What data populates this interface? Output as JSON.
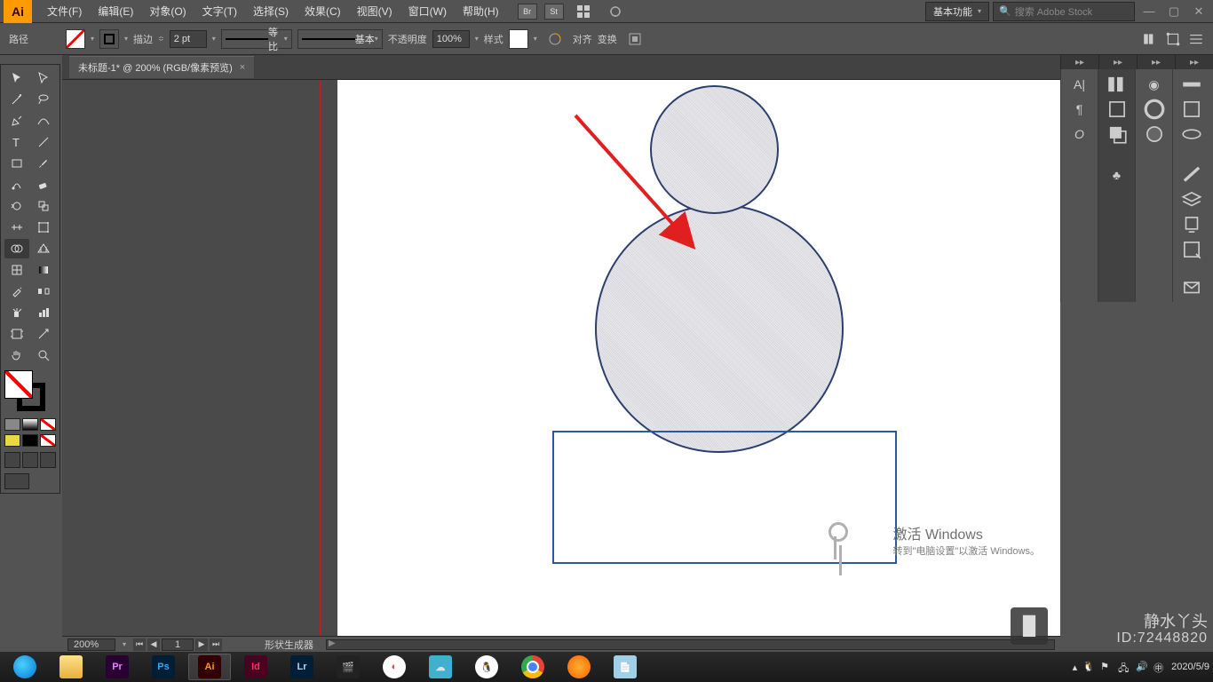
{
  "menubar": {
    "items": [
      "文件(F)",
      "编辑(E)",
      "对象(O)",
      "文字(T)",
      "选择(S)",
      "效果(C)",
      "视图(V)",
      "窗口(W)",
      "帮助(H)"
    ],
    "icon_boxes": [
      "Br",
      "St"
    ],
    "workspace": "基本功能",
    "search_placeholder": "搜索 Adobe Stock"
  },
  "controlbar": {
    "selection_label": "路径",
    "stroke_label": "描边",
    "stroke_weight": "2 pt",
    "profile_label": "等比",
    "brush_label": "基本",
    "opacity_label": "不透明度",
    "opacity_value": "100%",
    "style_label": "样式",
    "align_label": "对齐",
    "transform_label": "变换"
  },
  "document": {
    "tab_title": "未标题-1* @ 200% (RGB/像素预览)",
    "zoom": "200%",
    "artboard_num": "1",
    "status_tool": "形状生成器"
  },
  "watermark": {
    "activate": "激活 Windows",
    "activate_sub": "转到\"电脑设置\"以激活 Windows。",
    "brand_top": "静水丫头",
    "brand_id": "ID:72448820"
  },
  "taskbar": {
    "date": "2020/5/9",
    "apps": [
      "Pr",
      "Ps",
      "Ai",
      "Id",
      "Lr"
    ]
  }
}
